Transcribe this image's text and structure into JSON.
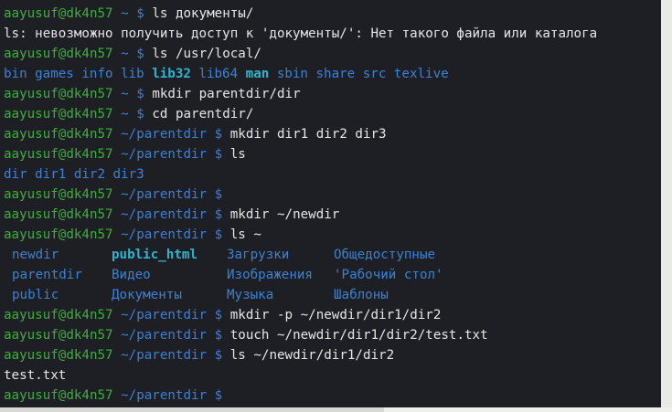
{
  "prompt": {
    "user": "aayusuf@dk4n57",
    "home": "~",
    "parentdir": "~/parentdir",
    "symbol": "$"
  },
  "commands": {
    "c1": "ls документы/",
    "c2": "ls /usr/local/",
    "c3": "mkdir parentdir/dir",
    "c4": "cd parentdir/",
    "c5": "mkdir dir1 dir2 dir3",
    "c6": "ls",
    "c7": "mkdir ~/newdir",
    "c8": "ls ~",
    "c9": "mkdir -p ~/newdir/dir1/dir2",
    "c10": "touch ~/newdir/dir1/dir2/test.txt",
    "c11": "ls ~/newdir/dir1/dir2"
  },
  "output": {
    "error": "ls: невозможно получить доступ к 'документы/': Нет такого файла или каталога",
    "usr_local": [
      "bin",
      "games",
      "info",
      "lib",
      "lib32",
      "lib64",
      "man",
      "sbin",
      "share",
      "src",
      "texlive"
    ],
    "parentdir_ls": [
      "dir",
      "dir1",
      "dir2",
      "dir3"
    ],
    "home_ls": [
      [
        "newdir",
        "public_html",
        "Загрузки",
        "Общедоступные"
      ],
      [
        "parentdir",
        "Видео",
        "Изображения",
        "'Рабочий стол'"
      ],
      [
        "public",
        "Документы",
        "Музыка",
        "Шаблоны"
      ]
    ],
    "test_file": "test.txt"
  },
  "colors": {
    "background": "#1e1f24",
    "user_host": "#3fae3f",
    "path": "#3d7fd6",
    "directory": "#3b82d4",
    "text": "#e6e6e6"
  }
}
